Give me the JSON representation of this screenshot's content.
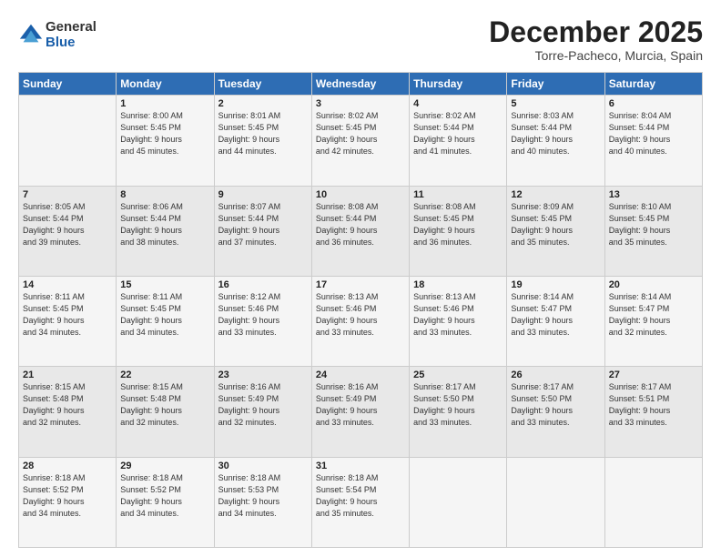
{
  "logo": {
    "general": "General",
    "blue": "Blue"
  },
  "title": "December 2025",
  "subtitle": "Torre-Pacheco, Murcia, Spain",
  "header_days": [
    "Sunday",
    "Monday",
    "Tuesday",
    "Wednesday",
    "Thursday",
    "Friday",
    "Saturday"
  ],
  "weeks": [
    [
      {
        "day": "",
        "info": ""
      },
      {
        "day": "1",
        "info": "Sunrise: 8:00 AM\nSunset: 5:45 PM\nDaylight: 9 hours\nand 45 minutes."
      },
      {
        "day": "2",
        "info": "Sunrise: 8:01 AM\nSunset: 5:45 PM\nDaylight: 9 hours\nand 44 minutes."
      },
      {
        "day": "3",
        "info": "Sunrise: 8:02 AM\nSunset: 5:45 PM\nDaylight: 9 hours\nand 42 minutes."
      },
      {
        "day": "4",
        "info": "Sunrise: 8:02 AM\nSunset: 5:44 PM\nDaylight: 9 hours\nand 41 minutes."
      },
      {
        "day": "5",
        "info": "Sunrise: 8:03 AM\nSunset: 5:44 PM\nDaylight: 9 hours\nand 40 minutes."
      },
      {
        "day": "6",
        "info": "Sunrise: 8:04 AM\nSunset: 5:44 PM\nDaylight: 9 hours\nand 40 minutes."
      }
    ],
    [
      {
        "day": "7",
        "info": "Sunrise: 8:05 AM\nSunset: 5:44 PM\nDaylight: 9 hours\nand 39 minutes."
      },
      {
        "day": "8",
        "info": "Sunrise: 8:06 AM\nSunset: 5:44 PM\nDaylight: 9 hours\nand 38 minutes."
      },
      {
        "day": "9",
        "info": "Sunrise: 8:07 AM\nSunset: 5:44 PM\nDaylight: 9 hours\nand 37 minutes."
      },
      {
        "day": "10",
        "info": "Sunrise: 8:08 AM\nSunset: 5:44 PM\nDaylight: 9 hours\nand 36 minutes."
      },
      {
        "day": "11",
        "info": "Sunrise: 8:08 AM\nSunset: 5:45 PM\nDaylight: 9 hours\nand 36 minutes."
      },
      {
        "day": "12",
        "info": "Sunrise: 8:09 AM\nSunset: 5:45 PM\nDaylight: 9 hours\nand 35 minutes."
      },
      {
        "day": "13",
        "info": "Sunrise: 8:10 AM\nSunset: 5:45 PM\nDaylight: 9 hours\nand 35 minutes."
      }
    ],
    [
      {
        "day": "14",
        "info": "Sunrise: 8:11 AM\nSunset: 5:45 PM\nDaylight: 9 hours\nand 34 minutes."
      },
      {
        "day": "15",
        "info": "Sunrise: 8:11 AM\nSunset: 5:45 PM\nDaylight: 9 hours\nand 34 minutes."
      },
      {
        "day": "16",
        "info": "Sunrise: 8:12 AM\nSunset: 5:46 PM\nDaylight: 9 hours\nand 33 minutes."
      },
      {
        "day": "17",
        "info": "Sunrise: 8:13 AM\nSunset: 5:46 PM\nDaylight: 9 hours\nand 33 minutes."
      },
      {
        "day": "18",
        "info": "Sunrise: 8:13 AM\nSunset: 5:46 PM\nDaylight: 9 hours\nand 33 minutes."
      },
      {
        "day": "19",
        "info": "Sunrise: 8:14 AM\nSunset: 5:47 PM\nDaylight: 9 hours\nand 33 minutes."
      },
      {
        "day": "20",
        "info": "Sunrise: 8:14 AM\nSunset: 5:47 PM\nDaylight: 9 hours\nand 32 minutes."
      }
    ],
    [
      {
        "day": "21",
        "info": "Sunrise: 8:15 AM\nSunset: 5:48 PM\nDaylight: 9 hours\nand 32 minutes."
      },
      {
        "day": "22",
        "info": "Sunrise: 8:15 AM\nSunset: 5:48 PM\nDaylight: 9 hours\nand 32 minutes."
      },
      {
        "day": "23",
        "info": "Sunrise: 8:16 AM\nSunset: 5:49 PM\nDaylight: 9 hours\nand 32 minutes."
      },
      {
        "day": "24",
        "info": "Sunrise: 8:16 AM\nSunset: 5:49 PM\nDaylight: 9 hours\nand 33 minutes."
      },
      {
        "day": "25",
        "info": "Sunrise: 8:17 AM\nSunset: 5:50 PM\nDaylight: 9 hours\nand 33 minutes."
      },
      {
        "day": "26",
        "info": "Sunrise: 8:17 AM\nSunset: 5:50 PM\nDaylight: 9 hours\nand 33 minutes."
      },
      {
        "day": "27",
        "info": "Sunrise: 8:17 AM\nSunset: 5:51 PM\nDaylight: 9 hours\nand 33 minutes."
      }
    ],
    [
      {
        "day": "28",
        "info": "Sunrise: 8:18 AM\nSunset: 5:52 PM\nDaylight: 9 hours\nand 34 minutes."
      },
      {
        "day": "29",
        "info": "Sunrise: 8:18 AM\nSunset: 5:52 PM\nDaylight: 9 hours\nand 34 minutes."
      },
      {
        "day": "30",
        "info": "Sunrise: 8:18 AM\nSunset: 5:53 PM\nDaylight: 9 hours\nand 34 minutes."
      },
      {
        "day": "31",
        "info": "Sunrise: 8:18 AM\nSunset: 5:54 PM\nDaylight: 9 hours\nand 35 minutes."
      },
      {
        "day": "",
        "info": ""
      },
      {
        "day": "",
        "info": ""
      },
      {
        "day": "",
        "info": ""
      }
    ]
  ]
}
